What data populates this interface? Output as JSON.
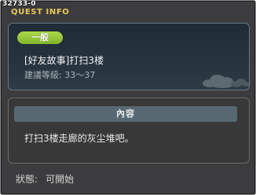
{
  "window": {
    "id": "32733-0",
    "title": "QUEST INFO"
  },
  "quest": {
    "category": "一般",
    "name": "[好友故事]打扫3楼",
    "level": "建議等級: 33〜37"
  },
  "content": {
    "header": "內容",
    "text": "打扫3楼走廊的灰尘堆吧。"
  },
  "status": {
    "label": "狀態:",
    "value": "可開始"
  },
  "colors": {
    "title": "#e8c95a",
    "badge": "#94c43a",
    "panel_header": "#586872"
  },
  "icons": {
    "decoration": "clouds-icon"
  }
}
